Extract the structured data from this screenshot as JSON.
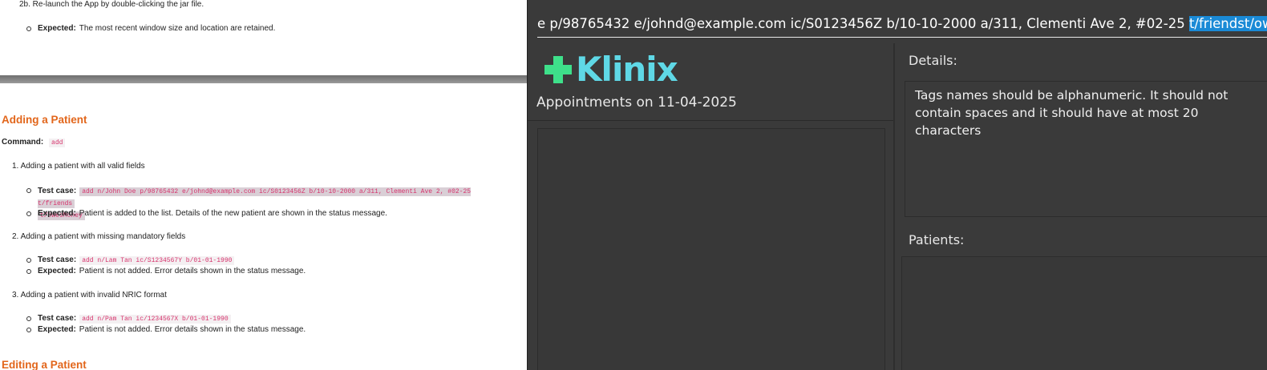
{
  "doc": {
    "relaunch_step": "2b. Re-launch the App by double-clicking the jar file.",
    "expected_label": "Expected:",
    "test_case_label": "Test case:",
    "relaunch_expected": "The most recent window size and location are retained.",
    "section_title": "Adding a Patient",
    "command_label": "Command:",
    "command_value": "add",
    "items": [
      {
        "title": "1. Adding a patient with all valid fields",
        "test_case_line1": "add n/John Doe p/98765432 e/johnd@example.com ic/S0123456Z b/10-10-2000 a/311, Clementi Ave 2, #02-25 t/friends",
        "test_case_line2": "t/owesMoney",
        "expected": "Patient is added to the list. Details of the new patient are shown in the status message."
      },
      {
        "title": "2. Adding a patient with missing mandatory fields",
        "test_case": "add n/Lam Tan ic/S1234567Y b/01-01-1990",
        "expected": "Patient is not added. Error details shown in the status message."
      },
      {
        "title": "3. Adding a patient with invalid NRIC format",
        "test_case": "add n/Pam Tan ic/1234567X b/01-01-1990",
        "expected": "Patient is not added. Error details shown in the status message."
      }
    ],
    "next_section_title": "Editing a Patient"
  },
  "app": {
    "command_text": "e p/98765432 e/johnd@example.com ic/S0123456Z b/10-10-2000 a/311, Clementi Ave 2, #02-25 ",
    "command_selected": "t/friendst/owesMoney",
    "logo_text": "Klinix",
    "appointments_title": "Appointments on 11-04-2025",
    "details_label": "Details:",
    "details_text": "Tags names should be alphanumeric. It should not contain spaces and it should have at most 20 characters",
    "patients_label": "Patients:",
    "colors": {
      "logo_cross": "#3ee08a",
      "logo_text": "#5fd8e6",
      "selection": "#1a8ad6",
      "heading": "#e2661b",
      "code": "#d6336c"
    }
  }
}
